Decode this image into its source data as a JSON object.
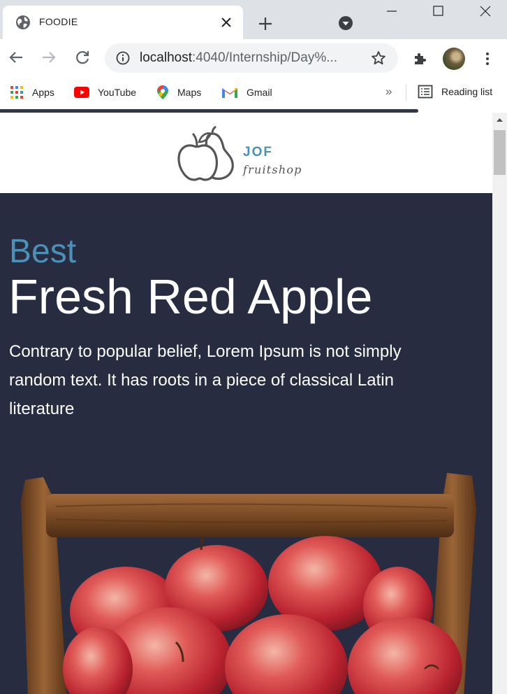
{
  "browser": {
    "tab_title": "FOODIE",
    "url_host": "localhost",
    "url_path": ":4040/Internship/Day%...",
    "bookmarks": [
      {
        "label": "Apps",
        "icon": "apps-grid-icon"
      },
      {
        "label": "YouTube",
        "icon": "youtube-icon"
      },
      {
        "label": "Maps",
        "icon": "maps-pin-icon"
      },
      {
        "label": "Gmail",
        "icon": "gmail-icon"
      }
    ],
    "bookmarks_overflow": "»",
    "reading_list": "Reading list"
  },
  "site": {
    "logo_brand": "JOF",
    "logo_tagline": "fruitshop"
  },
  "hero": {
    "kicker": "Best",
    "title": "Fresh Red Apple",
    "text": "Contrary to popular belief, Lorem Ipsum is not simply random text. It has roots in a piece of classical Latin literature",
    "image": "wooden-basket-of-red-apples"
  },
  "colors": {
    "hero_background": "#272c40",
    "accent_blue": "#4a90b8",
    "chrome_titlebar": "#dee1e6"
  }
}
